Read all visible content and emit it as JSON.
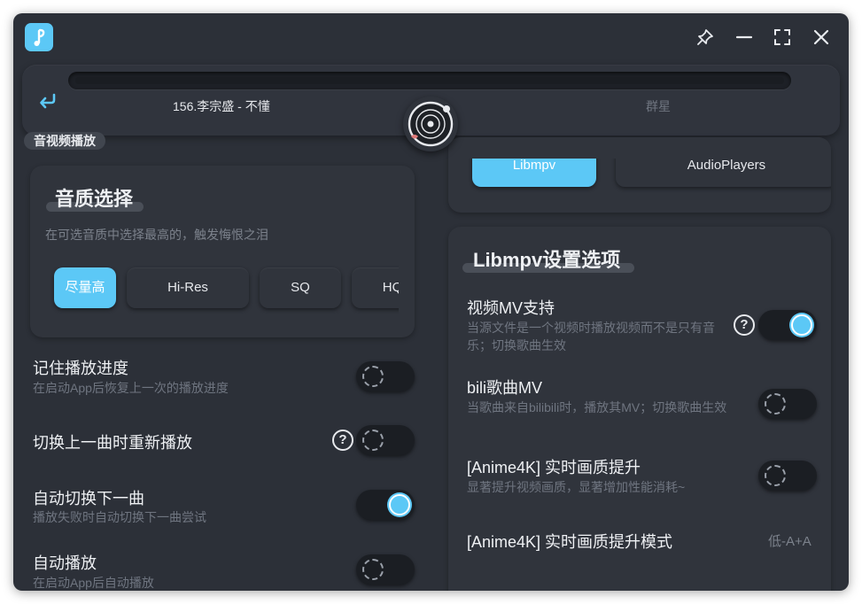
{
  "player": {
    "song_title": "156.李宗盛 - 不懂",
    "artist": "群星"
  },
  "section": {
    "label": "音视频播放"
  },
  "quality": {
    "title": "音质选择",
    "hint": "在可选音质中选择最高的，触发悔恨之泪",
    "options": [
      "尽量高",
      "Hi-Res",
      "SQ",
      "HQ"
    ],
    "selected": "尽量高"
  },
  "left_settings": [
    {
      "title": "记住播放进度",
      "desc": "在启动App后恢复上一次的播放进度",
      "on": false
    },
    {
      "title": "切换上一曲时重新播放",
      "desc": "",
      "on": false,
      "help": "?"
    },
    {
      "title": "自动切换下一曲",
      "desc": "播放失败时自动切换下一曲尝试",
      "on": true
    },
    {
      "title": "自动播放",
      "desc": "在启动App后自动播放",
      "on": false
    }
  ],
  "engine_tabs": {
    "options": [
      "Libmpv",
      "AudioPlayers"
    ],
    "selected": "Libmpv"
  },
  "libmpv": {
    "title": "Libmpv设置选项",
    "rows": [
      {
        "title": "视频MV支持",
        "desc": "当源文件是一个视频时播放视频而不是只有音乐；切换歌曲生效",
        "on": true,
        "help": "?"
      },
      {
        "title": "bili歌曲MV",
        "desc": "当歌曲来自bilibili时，播放其MV；切换歌曲生效",
        "on": false
      },
      {
        "title": "[Anime4K] 实时画质提升",
        "desc": "显著提升视频画质，显著增加性能消耗~",
        "on": false
      },
      {
        "title": "[Anime4K] 实时画质提升模式",
        "value": "低-A+A"
      }
    ]
  },
  "colors": {
    "accent": "#5cc8f6",
    "background": "#2c3038",
    "card": "#30343c"
  },
  "icons": [
    "app-logo-icon",
    "pin-icon",
    "minimize-icon",
    "maximize-icon",
    "close-icon",
    "back-icon",
    "vinyl-disc-icon",
    "help-icon"
  ]
}
